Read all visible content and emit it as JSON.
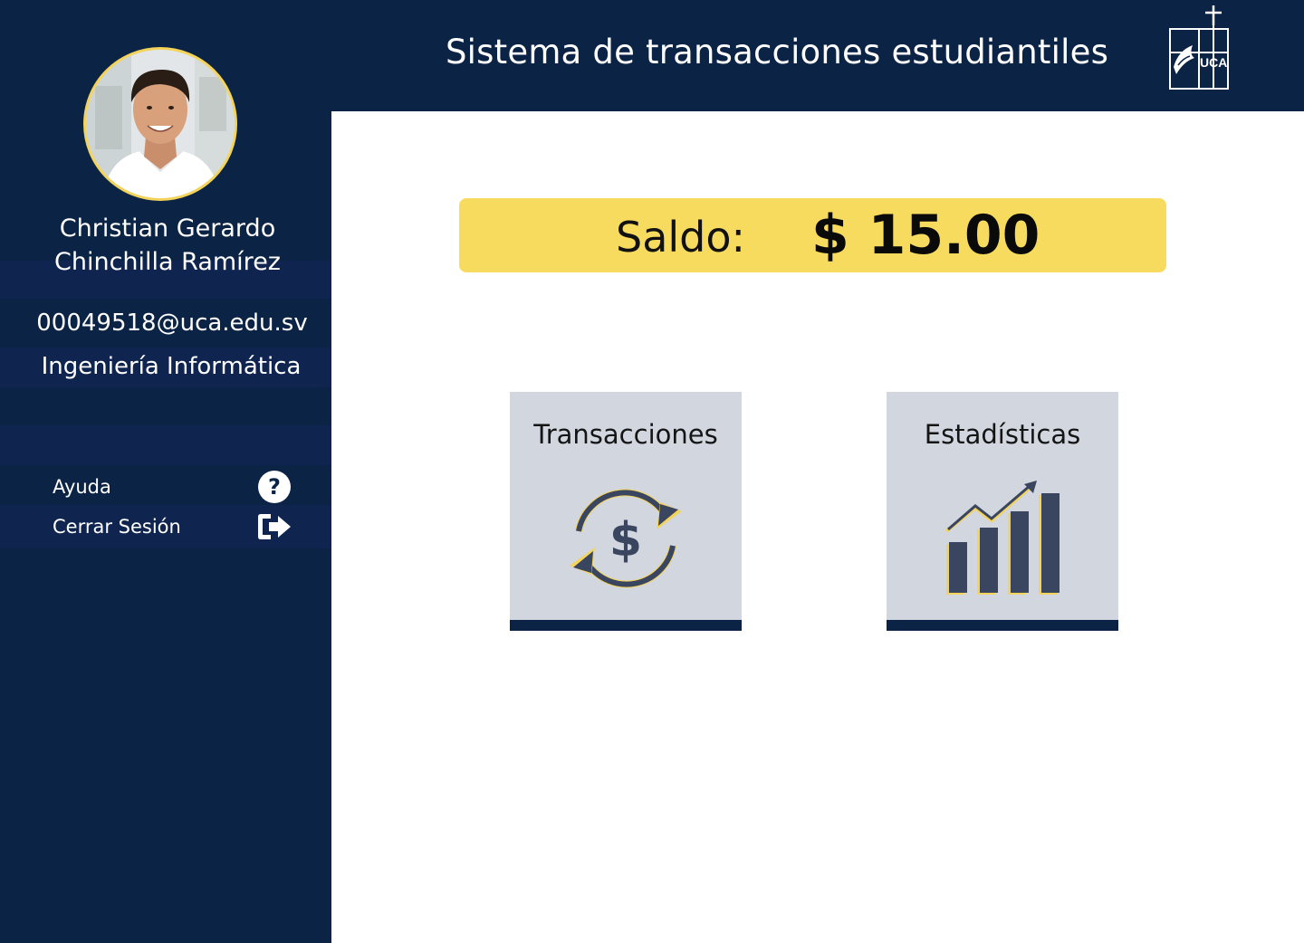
{
  "header": {
    "title": "Sistema de transacciones estudiantiles",
    "logo_text": "UCA"
  },
  "user": {
    "name_line1": "Christian Gerardo",
    "name_line2": "Chinchilla Ramírez",
    "email": "00049518@uca.edu.sv",
    "career": "Ingeniería Informática"
  },
  "menu": {
    "items": [
      {
        "label": "Ayuda",
        "icon": "help-icon"
      },
      {
        "label": "Cerrar Sesión",
        "icon": "logout-icon"
      }
    ]
  },
  "balance": {
    "label": "Saldo:",
    "value": "$ 15.00"
  },
  "tiles": [
    {
      "label": "Transacciones",
      "icon": "money-exchange-icon"
    },
    {
      "label": "Estadísticas",
      "icon": "bar-chart-growth-icon"
    }
  ],
  "colors": {
    "navy": "#0b2345",
    "accent_yellow": "#f7db5e",
    "tile_gray": "#d1d6df",
    "icon_navy": "#3a4560"
  }
}
